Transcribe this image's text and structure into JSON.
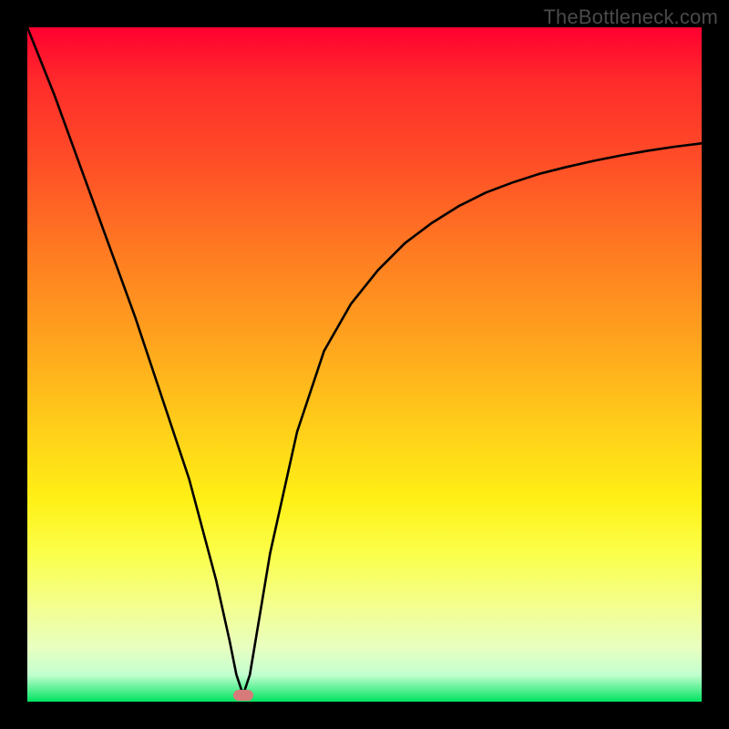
{
  "watermark": "TheBottleneck.com",
  "chart_data": {
    "type": "line",
    "title": "",
    "xlabel": "",
    "ylabel": "",
    "xlim": [
      0,
      100
    ],
    "ylim": [
      0,
      100
    ],
    "grid": false,
    "legend": false,
    "minimum_point": {
      "x": 32,
      "y": 1
    },
    "series": [
      {
        "name": "bottleneck-curve",
        "x": [
          0,
          4,
          8,
          12,
          16,
          20,
          24,
          28,
          30,
          31,
          32,
          33,
          34,
          36,
          40,
          44,
          48,
          52,
          56,
          60,
          64,
          68,
          72,
          76,
          80,
          84,
          88,
          92,
          96,
          100
        ],
        "y": [
          100,
          90,
          79,
          68,
          57,
          45,
          33,
          18,
          9,
          4,
          1,
          4,
          10,
          22,
          40,
          52,
          59,
          64,
          68,
          71,
          73.5,
          75.5,
          77,
          78.3,
          79.3,
          80.2,
          81,
          81.7,
          82.3,
          82.8
        ]
      }
    ],
    "marker": {
      "x": 32,
      "y": 1,
      "color": "#d77a7a"
    },
    "background_gradient": {
      "top": "#ff0030",
      "bottom": "#00e361"
    }
  }
}
